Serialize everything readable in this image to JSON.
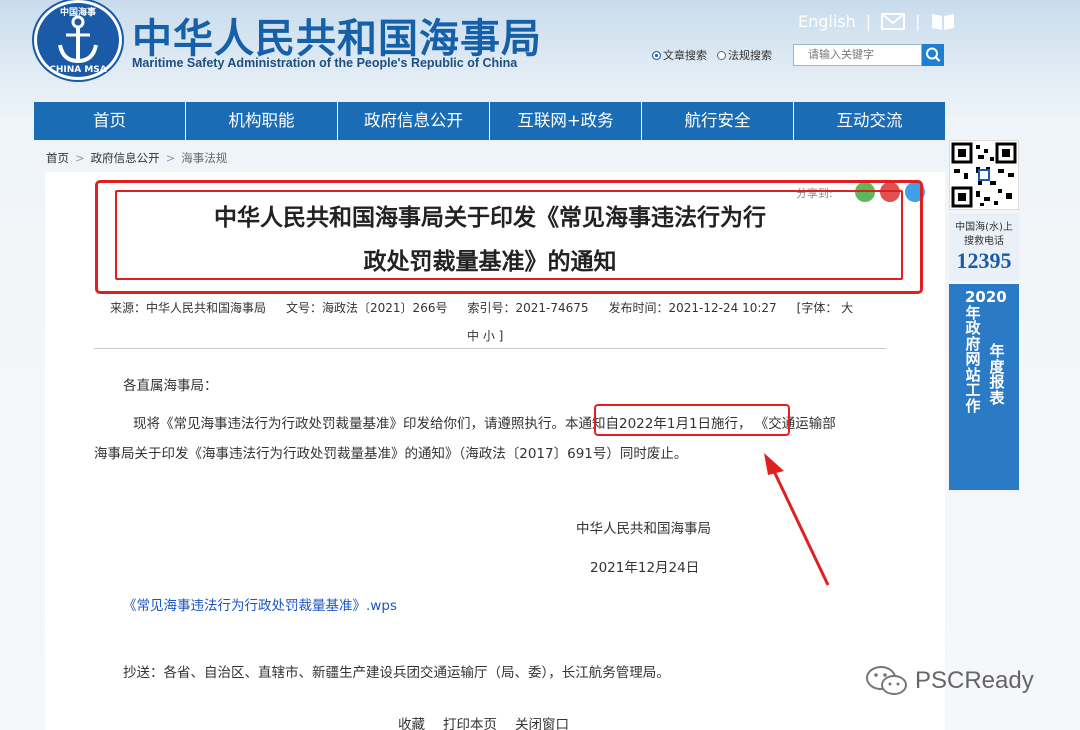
{
  "header": {
    "logo_text_top": "中国海事",
    "logo_text_bottom": "CHINA MSA",
    "site_title_cn": "中华人民共和国海事局",
    "site_title_en": "Maritime Safety Administration of the People's Republic of China",
    "english_link": "English",
    "search": {
      "option_article": "文章搜索",
      "option_law": "法规搜索",
      "placeholder": "请输入关键字"
    }
  },
  "nav": {
    "items": [
      "首页",
      "机构职能",
      "政府信息公开",
      "互联网+政务",
      "航行安全",
      "互动交流"
    ]
  },
  "breadcrumb": [
    "首页",
    "政府信息公开",
    "海事法规"
  ],
  "article": {
    "share_label": "分享到:",
    "title_line1": "中华人民共和国海事局关于印发《常见海事违法行为行",
    "title_line2": "政处罚裁量基准》的通知",
    "meta": {
      "source": "来源：中华人民共和国海事局",
      "doc_no": "文号：海政法〔2021〕266号",
      "index_no": "索引号：2021-74675",
      "publish_time": "发布时间：2021-12-24 10:27",
      "font_size_label": "[字体：  大",
      "font_size_rest": "中  小 ]"
    },
    "salutation": "各直属海事局：",
    "para1_a": "现将《常见海事违法行为行政处罚裁量基准》印发给你们，请遵照执行。",
    "para1_highlight": "本通知自2022年1月1日施行，",
    "para1_b": "《交通运输部",
    "para2": "海事局关于印发《海事违法行为行政处罚裁量基准》的通知》（海政法〔2017〕691号）同时废止。",
    "signature": "中华人民共和国海事局",
    "date": "2021年12月24日",
    "attachment": "《常见海事违法行为行政处罚裁量基准》.wps",
    "cc": "抄送：各省、自治区、直辖市、新疆生产建设兵团交通运输厅（局、委），长江航务管理局。",
    "bottom_links": [
      "收藏",
      "打印本页",
      "关闭窗口"
    ]
  },
  "sidebar": {
    "hotline_label_1": "中国海(水)上",
    "hotline_label_2": "搜救电话",
    "hotline_number": "12395",
    "annual_col1": "2020年政府网站工作",
    "annual_col2": "年度报表"
  },
  "watermark": "PSCReady",
  "colors": {
    "nav_bg": "#1a6db5",
    "brand": "#1560a8",
    "highlight_red": "#e02020",
    "link": "#1a56c4"
  }
}
